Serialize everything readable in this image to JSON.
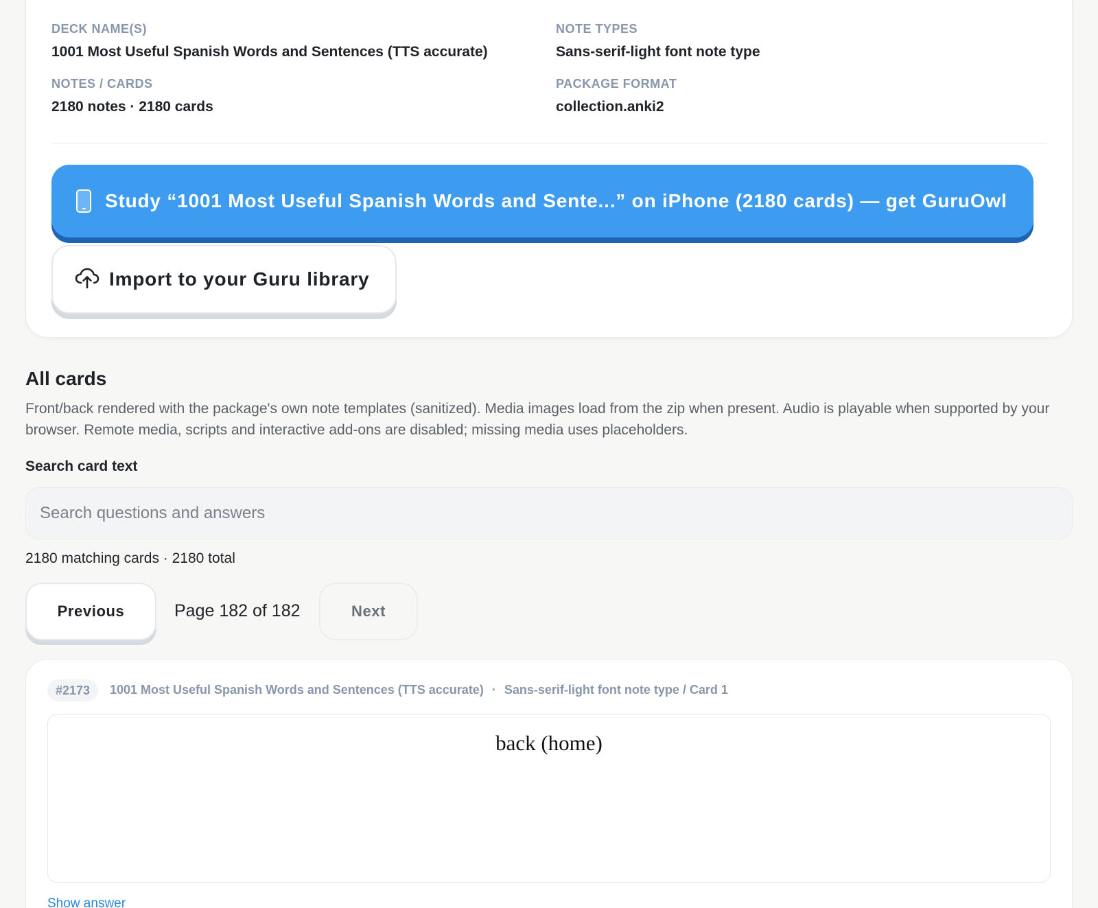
{
  "summary": {
    "deck_names_label": "DECK NAME(S)",
    "deck_names_value": "1001 Most Useful Spanish Words and Sentences (TTS accurate)",
    "note_types_label": "NOTE TYPES",
    "note_types_value": "Sans-serif-light font note type",
    "notes_cards_label": "NOTES / CARDS",
    "notes_cards_value": "2180 notes · 2180 cards",
    "package_format_label": "PACKAGE FORMAT",
    "package_format_value": "collection.anki2"
  },
  "actions": {
    "study_label": "Study “1001 Most Useful Spanish Words and Sente...” on iPhone (2180 cards) — get GuruOwl",
    "study_icon": "phone-icon",
    "import_label": "Import to your Guru library",
    "import_icon": "cloud-upload-icon"
  },
  "all_cards": {
    "title": "All cards",
    "description": "Front/back rendered with the package's own note templates (sanitized). Media images load from the zip when present. Audio is playable when supported by your browser. Remote media, scripts and interactive add-ons are disabled; missing media uses placeholders.",
    "search_label": "Search card text",
    "search_placeholder": "Search questions and answers",
    "search_value": "",
    "match_count": "2180 matching cards · 2180 total"
  },
  "pagination": {
    "previous_label": "Previous",
    "page_text": "Page 182 of 182",
    "next_label": "Next"
  },
  "card": {
    "id": "#2173",
    "deck": "1001 Most Useful Spanish Words and Sentences (TTS accurate)",
    "separator": "·",
    "note_type": "Sans-serif-light font note type / Card 1",
    "front_text": "back (home)",
    "show_answer_label": "Show answer"
  },
  "colors": {
    "accent_blue": "#3d9cf0",
    "accent_blue_shadow": "#1f64b3",
    "label_gray": "#8896ab",
    "link_blue": "#2b86d9"
  }
}
